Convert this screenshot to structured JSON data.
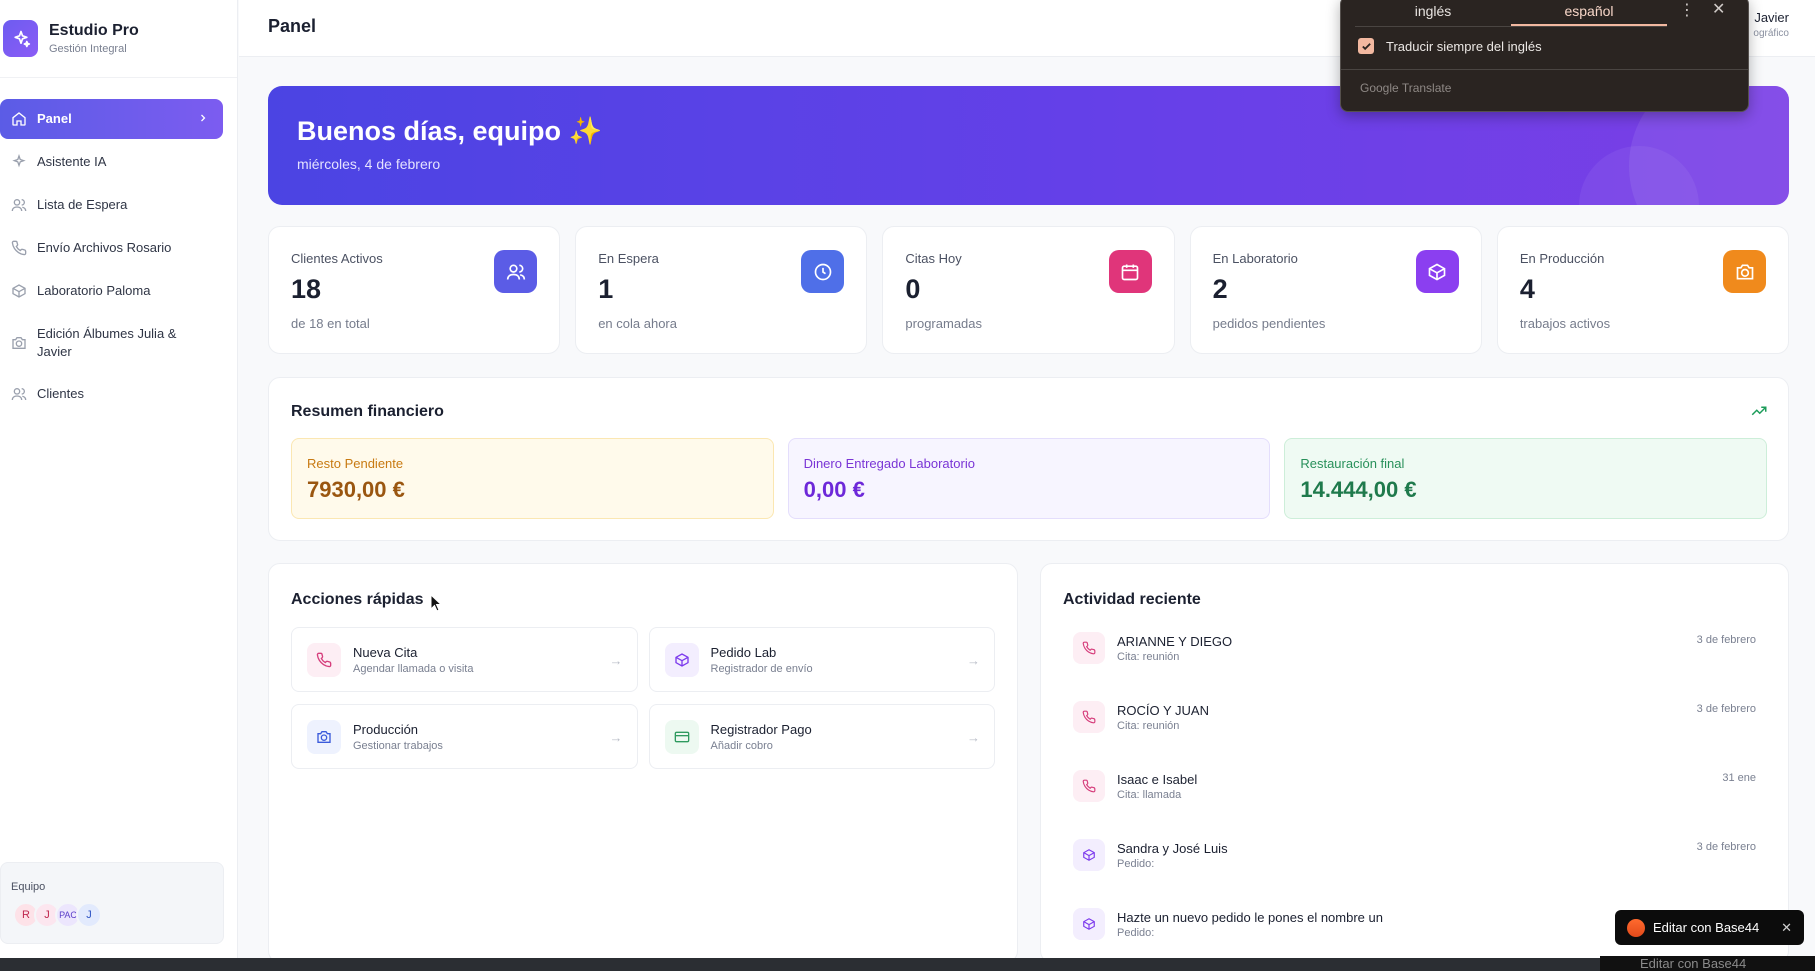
{
  "brand": {
    "name": "Estudio Pro",
    "subtitle": "Gestión Integral"
  },
  "nav": [
    {
      "label": "Panel",
      "icon": "home-icon",
      "active": true
    },
    {
      "label": "Asistente IA",
      "icon": "sparkles-icon"
    },
    {
      "label": "Lista de Espera",
      "icon": "users-icon"
    },
    {
      "label": "Envío Archivos Rosario",
      "icon": "phone-icon"
    },
    {
      "label": "Laboratorio Paloma",
      "icon": "box-icon"
    },
    {
      "label": "Edición Álbumes Julia & Javier",
      "icon": "camera-icon"
    },
    {
      "label": "Clientes",
      "icon": "users-icon"
    }
  ],
  "team": {
    "label": "Equipo",
    "members": [
      "R",
      "J",
      "PAC",
      "J"
    ]
  },
  "header": {
    "title": "Panel",
    "user_name": "Javier",
    "user_role": "ográfico"
  },
  "hero": {
    "greeting": "Buenos días, equipo ✨",
    "date": "miércoles, 4 de febrero"
  },
  "stats": [
    {
      "label": "Clientes Activos",
      "value": "18",
      "sub": "de 18 en total",
      "icon": "users-icon",
      "color": "#5b5ce6"
    },
    {
      "label": "En Espera",
      "value": "1",
      "sub": "en cola ahora",
      "icon": "clock-icon",
      "color": "#4f6fe8"
    },
    {
      "label": "Citas Hoy",
      "value": "0",
      "sub": "programadas",
      "icon": "calendar-icon",
      "color": "#e0357a"
    },
    {
      "label": "En Laboratorio",
      "value": "2",
      "sub": "pedidos pendientes",
      "icon": "box-icon",
      "color": "#8b3ff0"
    },
    {
      "label": "En Producción",
      "value": "4",
      "sub": "trabajos activos",
      "icon": "camera-icon",
      "color": "#f08a1c"
    }
  ],
  "finance": {
    "title": "Resumen financiero",
    "cards": [
      {
        "label": "Resto Pendiente",
        "value": "7930,00 €",
        "bg": "#fffaeb",
        "border": "#fbe7b2",
        "label_color": "#c87a12",
        "value_color": "#9a5610"
      },
      {
        "label": "Dinero Entregado Laboratorio",
        "value": "0,00 €",
        "bg": "#f7f5ff",
        "border": "#e4defc",
        "label_color": "#7a35d6",
        "value_color": "#6d28d9"
      },
      {
        "label": "Restauración final",
        "value": "14.444,00 €",
        "bg": "#effaf3",
        "border": "#cdeed9",
        "label_color": "#28905a",
        "value_color": "#1f7a4c"
      }
    ]
  },
  "quick": {
    "title": "Acciones rápidas",
    "actions": [
      {
        "title": "Nueva Cita",
        "sub": "Agendar llamada o visita",
        "icon": "phone-icon",
        "bg": "#fdeef4",
        "fg": "#d63e7c"
      },
      {
        "title": "Pedido Lab",
        "sub": "Registrador de envío",
        "icon": "box-icon",
        "bg": "#f3eefe",
        "fg": "#7c3aed"
      },
      {
        "title": "Producción",
        "sub": "Gestionar trabajos",
        "icon": "camera-icon",
        "bg": "#eef2fe",
        "fg": "#3b5bdb"
      },
      {
        "title": "Registrador Pago",
        "sub": "Añadir cobro",
        "icon": "card-icon",
        "bg": "#edf9f1",
        "fg": "#2f9a5f"
      }
    ]
  },
  "activity": {
    "title": "Actividad reciente",
    "items": [
      {
        "name": "ARIANNE Y DIEGO",
        "sub": "Cita: reunión",
        "date": "3 de febrero",
        "icon": "phone-icon"
      },
      {
        "name": "ROCÍO Y JUAN",
        "sub": "Cita: reunión",
        "date": "3 de febrero",
        "icon": "phone-icon"
      },
      {
        "name": "Isaac e Isabel",
        "sub": "Cita: llamada",
        "date": "31 ene",
        "icon": "phone-icon"
      },
      {
        "name": "Sandra y José Luis",
        "sub": "Pedido:",
        "date": "3 de febrero",
        "icon": "box-icon"
      },
      {
        "name": "Hazte un nuevo pedido le pones el nombre un",
        "sub": "Pedido:",
        "date": "",
        "icon": "box-icon"
      }
    ]
  },
  "translate": {
    "tab_from": "inglés",
    "tab_to": "español",
    "always_label": "Traducir siempre del inglés",
    "brand": "Google Translate"
  },
  "badge": {
    "label": "Editar con Base44",
    "ghost": "Editar con Base44"
  }
}
